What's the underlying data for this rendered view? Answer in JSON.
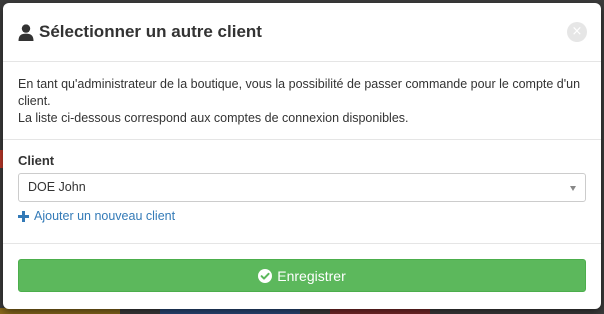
{
  "modal": {
    "title": "Sélectionner un autre client",
    "title_icon": "user-icon",
    "close_glyph": "×",
    "intro_line1": "En tant qu'administrateur de la boutique, vous la possibilité de passer commande pour le compte d'un client.",
    "intro_line2": "La liste ci-dessous correspond aux comptes de connexion disponibles."
  },
  "form": {
    "client_label": "Client",
    "client_selected": "DOE John",
    "add_client_label": "Ajouter un nouveau client"
  },
  "footer": {
    "submit_label": "Enregistrer"
  },
  "colors": {
    "submit_bg": "#5cb85c",
    "link": "#337ab7"
  }
}
